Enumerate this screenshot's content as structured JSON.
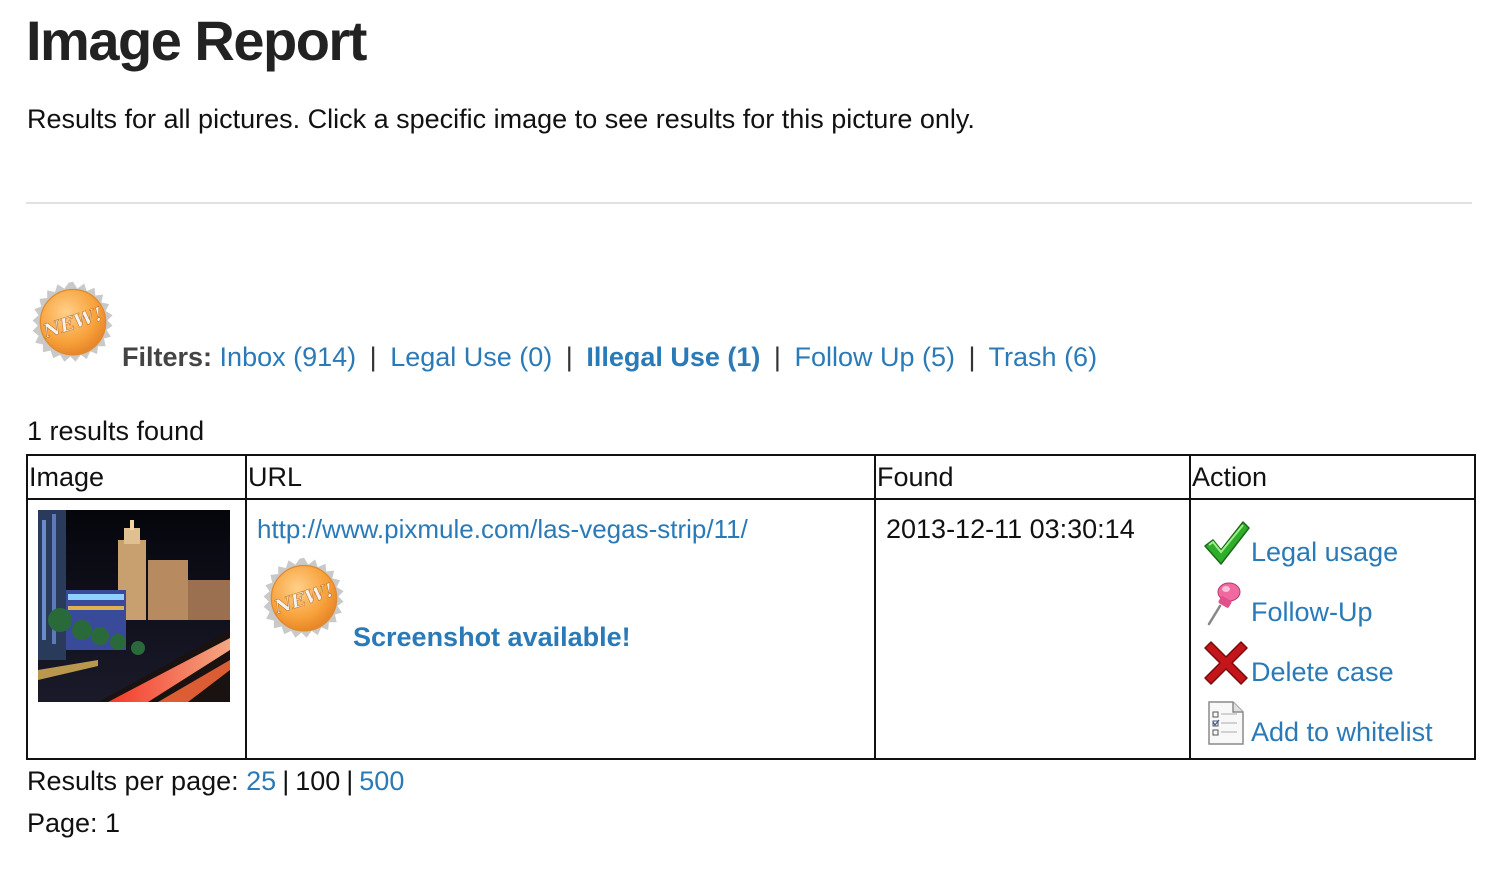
{
  "header": {
    "title": "Image Report",
    "intro": "Results for all pictures. Click a specific image to see results for this picture only."
  },
  "filters": {
    "label": "Filters:",
    "items": [
      {
        "label": "Inbox (914)"
      },
      {
        "label": "Legal Use (0)"
      },
      {
        "label": "Illegal Use (1)"
      },
      {
        "label": "Follow Up (5)"
      },
      {
        "label": "Trash (6)"
      }
    ],
    "separator": "|",
    "badge_text": "NEW!"
  },
  "results": {
    "count_text": "1 results found",
    "columns": [
      "Image",
      "URL",
      "Found",
      "Action"
    ],
    "rows": [
      {
        "url": "http://www.pixmule.com/las-vegas-strip/11/",
        "screenshot_label": "Screenshot available!",
        "found": "2013-12-11 03:30:14",
        "actions": [
          {
            "label": "Legal usage",
            "icon": "checkmark-icon"
          },
          {
            "label": "Follow-Up",
            "icon": "pushpin-icon"
          },
          {
            "label": "Delete case",
            "icon": "red-x-icon"
          },
          {
            "label": "Add to whitelist",
            "icon": "checklist-document-icon"
          }
        ]
      }
    ]
  },
  "pagination": {
    "per_page_label": "Results per page:",
    "options": [
      "25",
      "100",
      "500"
    ],
    "page_text": "Page: 1"
  },
  "colors": {
    "link": "#2a7ab8",
    "badge": "#f7a13a",
    "divider": "#e1e1e1"
  }
}
